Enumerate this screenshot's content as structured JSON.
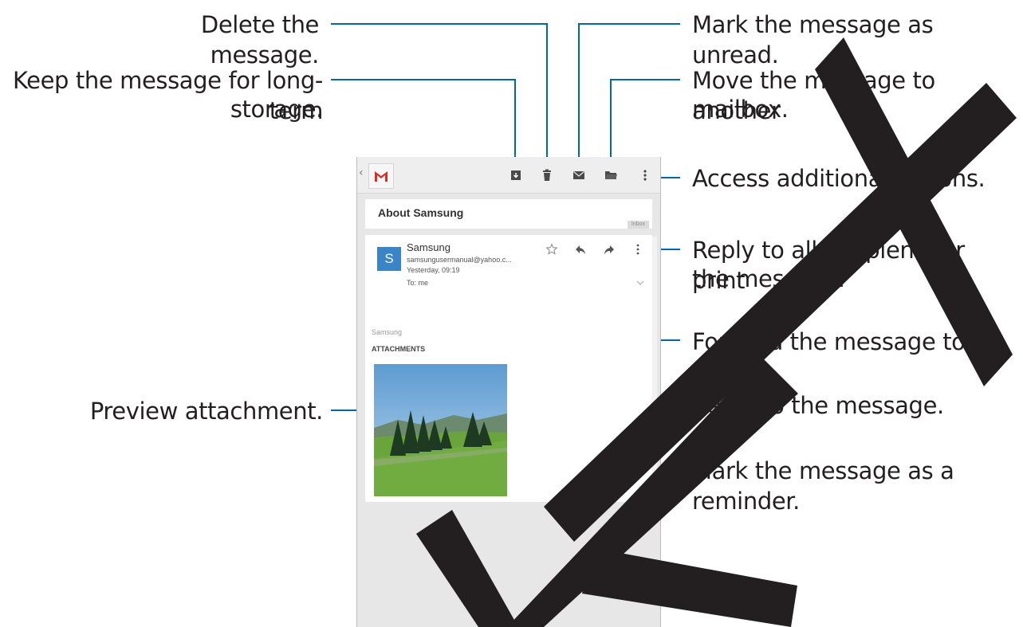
{
  "callouts": {
    "delete": "Delete the message.",
    "archive_line1": "Keep the message for long-term",
    "archive_line2": "storage.",
    "unread": "Mark the message as unread.",
    "move_line1": "Move the message to another",
    "move_line2": "mailbox.",
    "more": "Access additional options.",
    "reply_all_line1": "Reply to all recipients or print",
    "reply_all_line2": "the message.",
    "forward": "Forward the message to others.",
    "reply": "Reply to the message.",
    "star": "Mark the message as a reminder.",
    "preview": "Preview attachment."
  },
  "email": {
    "back_glyph": "‹",
    "subject": "About Samsung",
    "label": "Inbox",
    "avatar_letter": "S",
    "sender": "Samsung",
    "address": "samsungusermanual@yahoo.c...",
    "time": "Yesterday, 09:19",
    "to": "To: me",
    "body": "Samsung",
    "attachments_header": "ATTACHMENTS"
  },
  "icons": {
    "app": "gmail-logo",
    "archive": "archive-icon",
    "delete": "trash-icon",
    "unread": "envelope-icon",
    "move": "folder-icon",
    "more": "overflow-menu-icon",
    "star": "star-outline-icon",
    "reply": "reply-icon",
    "forward": "forward-icon",
    "message_more": "overflow-menu-icon",
    "expand": "chevron-down-icon"
  },
  "colors": {
    "leader": "#0067a8",
    "avatar": "#3a85c8",
    "gmail_red": "#d93025",
    "watermark": "#231f20"
  }
}
